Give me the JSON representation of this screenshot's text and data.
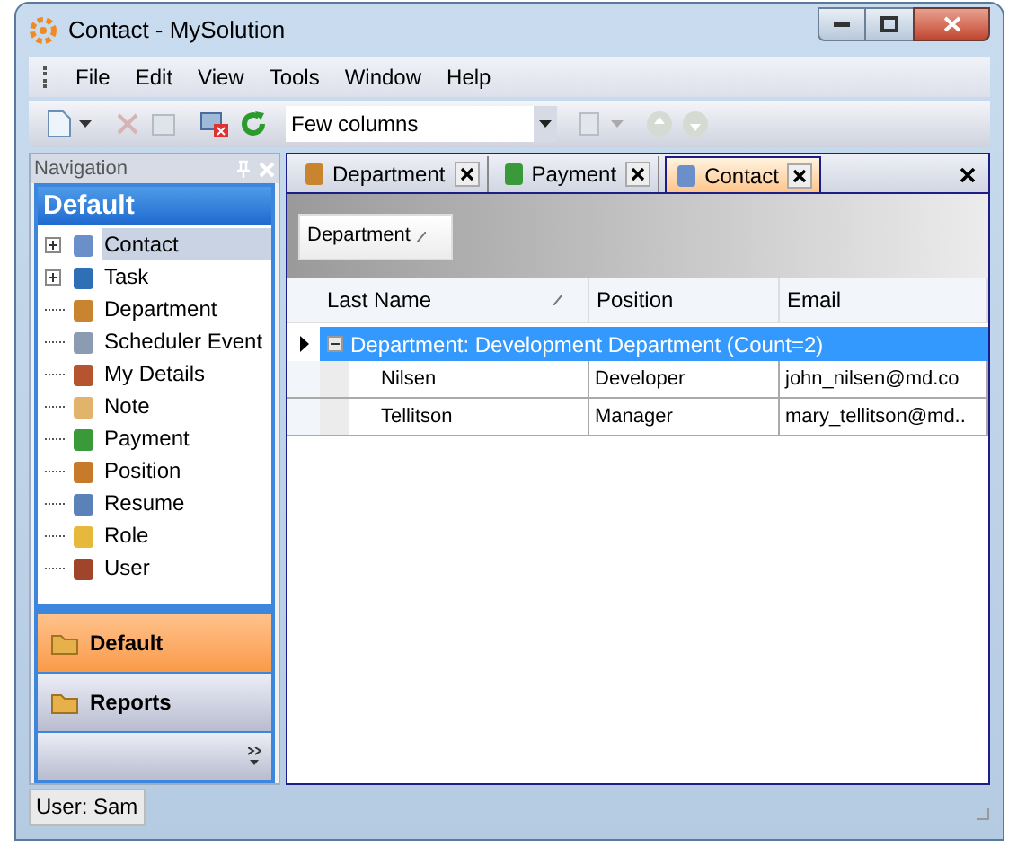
{
  "window": {
    "title": "Contact - MySolution"
  },
  "menu": [
    "File",
    "Edit",
    "View",
    "Tools",
    "Window",
    "Help"
  ],
  "toolbar": {
    "view_combo": {
      "value": "Few columns"
    }
  },
  "navigation": {
    "title": "Navigation",
    "group_header": "Default",
    "items": [
      {
        "label": "Contact",
        "selected": true,
        "expandable": true
      },
      {
        "label": "Task",
        "selected": false,
        "expandable": true
      },
      {
        "label": "Department",
        "selected": false,
        "expandable": false
      },
      {
        "label": "Scheduler Event",
        "selected": false,
        "expandable": false
      },
      {
        "label": "My Details",
        "selected": false,
        "expandable": false
      },
      {
        "label": "Note",
        "selected": false,
        "expandable": false
      },
      {
        "label": "Payment",
        "selected": false,
        "expandable": false
      },
      {
        "label": "Position",
        "selected": false,
        "expandable": false
      },
      {
        "label": "Resume",
        "selected": false,
        "expandable": false
      },
      {
        "label": "Role",
        "selected": false,
        "expandable": false
      },
      {
        "label": "User",
        "selected": false,
        "expandable": false
      }
    ],
    "groups": [
      {
        "label": "Default",
        "selected": true
      },
      {
        "label": "Reports",
        "selected": false
      }
    ]
  },
  "tabs": [
    {
      "label": "Department",
      "selected": false
    },
    {
      "label": "Payment",
      "selected": false
    },
    {
      "label": "Contact",
      "selected": true
    }
  ],
  "group_panel": {
    "field": "Department"
  },
  "table": {
    "columns": [
      "Last Name",
      "Position",
      "Email"
    ],
    "group_row": {
      "text": "Department: Development Department (Count=2)",
      "expanded": true
    },
    "rows": [
      [
        "Nilsen",
        "Developer",
        "john_nilsen@md.co"
      ],
      [
        "Tellitson",
        "Manager",
        "mary_tellitson@md.."
      ]
    ]
  },
  "status_bar": {
    "user": "User: Sam"
  }
}
